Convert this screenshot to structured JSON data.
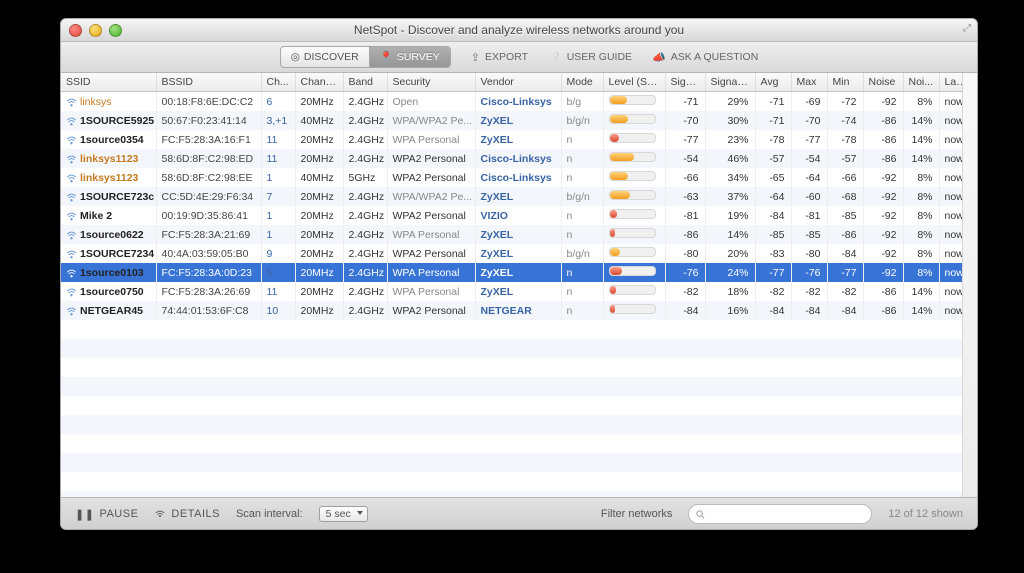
{
  "window": {
    "title": "NetSpot - Discover and analyze wireless networks around you"
  },
  "toolbar": {
    "discover": "DISCOVER",
    "survey": "SURVEY",
    "export": "EXPORT",
    "userguide": "USER GUIDE",
    "ask": "ASK A QUESTION"
  },
  "columns": [
    "SSID",
    "BSSID",
    "Ch...",
    "Chann...",
    "Band",
    "Security",
    "Vendor",
    "Mode",
    "Level (SNR)",
    "Signal",
    "Signal %",
    "Avg",
    "Max",
    "Min",
    "Noise",
    "Noi...",
    "Las..."
  ],
  "rows": [
    {
      "ssid": "linksys",
      "ssid_style": "orange-plain",
      "bssid": "00:18:F8:6E:DC:C2",
      "ch": "6",
      "chw": "20MHz",
      "band": "2.4GHz",
      "sec": "Open",
      "sec_gray": true,
      "vendor": "Cisco-Linksys",
      "mode": "b/g",
      "lvl_pct": 38,
      "lvl_col": "o",
      "signal": "-71",
      "sigpct": "29%",
      "avg": "-71",
      "max": "-69",
      "min": "-72",
      "noise": "-92",
      "noipct": "8%",
      "last": "now",
      "selected": false
    },
    {
      "ssid": "1SOURCE5925",
      "ssid_style": "bold",
      "bssid": "50:67:F0:23:41:14",
      "ch": "3,+1",
      "chw": "40MHz",
      "band": "2.4GHz",
      "sec": "WPA/WPA2 Pe...",
      "sec_gray": true,
      "vendor": "ZyXEL",
      "mode": "b/g/n",
      "lvl_pct": 40,
      "lvl_col": "o",
      "signal": "-70",
      "sigpct": "30%",
      "avg": "-71",
      "max": "-70",
      "min": "-74",
      "noise": "-86",
      "noipct": "14%",
      "last": "now",
      "selected": false
    },
    {
      "ssid": "1source0354",
      "ssid_style": "bold",
      "bssid": "FC:F5:28:3A:16:F1",
      "ch": "11",
      "chw": "20MHz",
      "band": "2.4GHz",
      "sec": "WPA Personal",
      "sec_gray": true,
      "vendor": "ZyXEL",
      "mode": "n",
      "lvl_pct": 20,
      "lvl_col": "r",
      "signal": "-77",
      "sigpct": "23%",
      "avg": "-78",
      "max": "-77",
      "min": "-78",
      "noise": "-86",
      "noipct": "14%",
      "last": "now",
      "selected": false
    },
    {
      "ssid": "linksys1123",
      "ssid_style": "orange",
      "bssid": "58:6D:8F:C2:98:ED",
      "ch": "11",
      "chw": "20MHz",
      "band": "2.4GHz",
      "sec": "WPA2 Personal",
      "sec_gray": false,
      "vendor": "Cisco-Linksys",
      "mode": "n",
      "lvl_pct": 55,
      "lvl_col": "o",
      "signal": "-54",
      "sigpct": "46%",
      "avg": "-57",
      "max": "-54",
      "min": "-57",
      "noise": "-86",
      "noipct": "14%",
      "last": "now",
      "selected": false
    },
    {
      "ssid": "linksys1123",
      "ssid_style": "orange",
      "bssid": "58:6D:8F:C2:98:EE",
      "ch": "1",
      "chw": "40MHz",
      "band": "5GHz",
      "sec": "WPA2 Personal",
      "sec_gray": false,
      "vendor": "Cisco-Linksys",
      "mode": "n",
      "lvl_pct": 42,
      "lvl_col": "o",
      "signal": "-66",
      "sigpct": "34%",
      "avg": "-65",
      "max": "-64",
      "min": "-66",
      "noise": "-92",
      "noipct": "8%",
      "last": "now",
      "selected": false
    },
    {
      "ssid": "1SOURCE723c",
      "ssid_style": "bold",
      "bssid": "CC:5D:4E:29:F6:34",
      "ch": "7",
      "chw": "20MHz",
      "band": "2.4GHz",
      "sec": "WPA/WPA2 Pe...",
      "sec_gray": true,
      "vendor": "ZyXEL",
      "mode": "b/g/n",
      "lvl_pct": 45,
      "lvl_col": "o",
      "signal": "-63",
      "sigpct": "37%",
      "avg": "-64",
      "max": "-60",
      "min": "-68",
      "noise": "-92",
      "noipct": "8%",
      "last": "now",
      "selected": false
    },
    {
      "ssid": "Mike 2",
      "ssid_style": "bold",
      "bssid": "00:19:9D:35:86:41",
      "ch": "1",
      "chw": "20MHz",
      "band": "2.4GHz",
      "sec": "WPA2 Personal",
      "sec_gray": false,
      "vendor": "VIZIO",
      "mode": "n",
      "lvl_pct": 16,
      "lvl_col": "r",
      "signal": "-81",
      "sigpct": "19%",
      "avg": "-84",
      "max": "-81",
      "min": "-85",
      "noise": "-92",
      "noipct": "8%",
      "last": "now",
      "selected": false
    },
    {
      "ssid": "1source0622",
      "ssid_style": "bold",
      "bssid": "FC:F5:28:3A:21:69",
      "ch": "1",
      "chw": "20MHz",
      "band": "2.4GHz",
      "sec": "WPA Personal",
      "sec_gray": true,
      "vendor": "ZyXEL",
      "mode": "n",
      "lvl_pct": 12,
      "lvl_col": "r",
      "signal": "-86",
      "sigpct": "14%",
      "avg": "-85",
      "max": "-85",
      "min": "-86",
      "noise": "-92",
      "noipct": "8%",
      "last": "now",
      "selected": false
    },
    {
      "ssid": "1SOURCE7234",
      "ssid_style": "bold",
      "bssid": "40:4A:03:59:05:B0",
      "ch": "9",
      "chw": "20MHz",
      "band": "2.4GHz",
      "sec": "WPA2 Personal",
      "sec_gray": false,
      "vendor": "ZyXEL",
      "mode": "b/g/n",
      "lvl_pct": 24,
      "lvl_col": "o",
      "signal": "-80",
      "sigpct": "20%",
      "avg": "-83",
      "max": "-80",
      "min": "-84",
      "noise": "-92",
      "noipct": "8%",
      "last": "now",
      "selected": false
    },
    {
      "ssid": "1source0103",
      "ssid_style": "bold",
      "bssid": "FC:F5:28:3A:0D:23",
      "ch": "6",
      "chw": "20MHz",
      "band": "2.4GHz",
      "sec": "WPA Personal",
      "sec_gray": true,
      "vendor": "ZyXEL",
      "mode": "n",
      "lvl_pct": 28,
      "lvl_col": "r",
      "signal": "-76",
      "sigpct": "24%",
      "avg": "-77",
      "max": "-76",
      "min": "-77",
      "noise": "-92",
      "noipct": "8%",
      "last": "now",
      "selected": true
    },
    {
      "ssid": "1source0750",
      "ssid_style": "bold",
      "bssid": "FC:F5:28:3A:26:69",
      "ch": "11",
      "chw": "20MHz",
      "band": "2.4GHz",
      "sec": "WPA Personal",
      "sec_gray": true,
      "vendor": "ZyXEL",
      "mode": "n",
      "lvl_pct": 14,
      "lvl_col": "r",
      "signal": "-82",
      "sigpct": "18%",
      "avg": "-82",
      "max": "-82",
      "min": "-82",
      "noise": "-86",
      "noipct": "14%",
      "last": "now",
      "selected": false
    },
    {
      "ssid": "NETGEAR45",
      "ssid_style": "bold",
      "bssid": "74:44:01:53:6F:C8",
      "ch": "10",
      "chw": "20MHz",
      "band": "2.4GHz",
      "sec": "WPA2 Personal",
      "sec_gray": false,
      "vendor": "NETGEAR",
      "mode": "n",
      "lvl_pct": 13,
      "lvl_col": "r",
      "signal": "-84",
      "sigpct": "16%",
      "avg": "-84",
      "max": "-84",
      "min": "-84",
      "noise": "-86",
      "noipct": "14%",
      "last": "now",
      "selected": false
    }
  ],
  "footer": {
    "pause": "PAUSE",
    "details": "DETAILS",
    "interval_label": "Scan interval:",
    "interval_value": "5 sec",
    "filter_label": "Filter networks",
    "count": "12 of 12 shown"
  }
}
